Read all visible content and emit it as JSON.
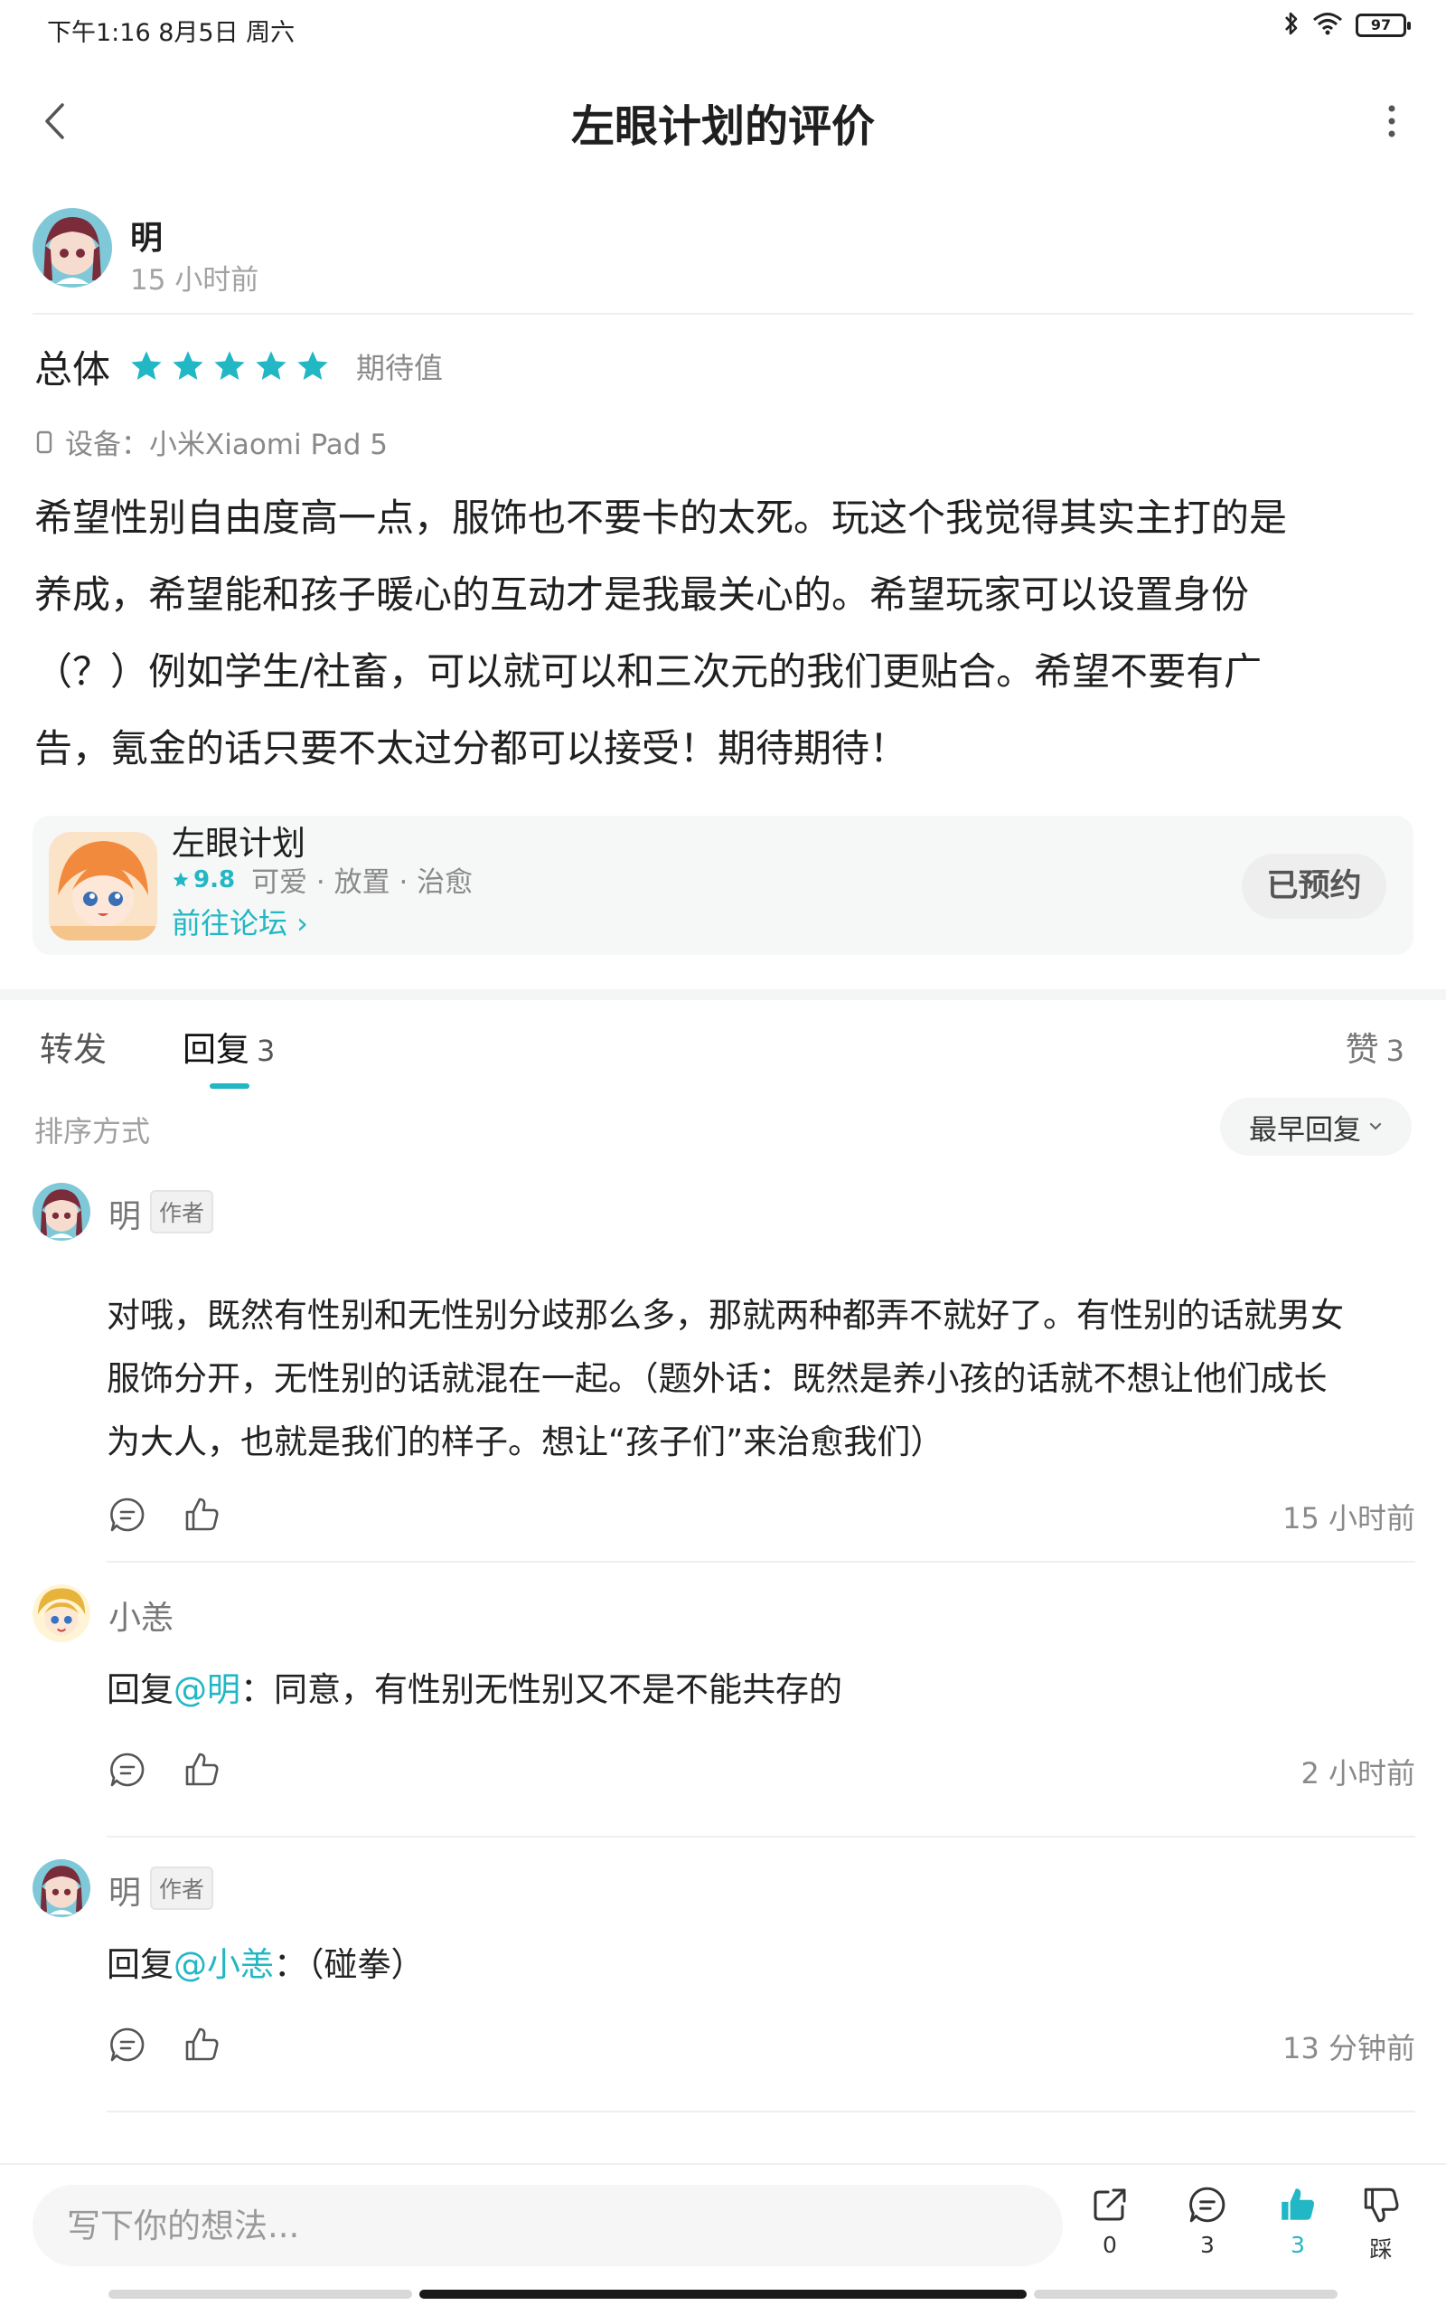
{
  "status_bar": {
    "time_date": "下午1:16  8月5日 周六",
    "battery": "97"
  },
  "nav": {
    "title": "左眼计划的评价"
  },
  "review": {
    "author": "明",
    "time": "15 小时前",
    "rating_label": "总体",
    "stars": 5,
    "rating_tag": "期待值",
    "device_label": "设备：",
    "device": "小米Xiaomi Pad 5",
    "lines": [
      "希望性别自由度高一点，服饰也不要卡的太死。玩这个我觉得其实主打的是",
      "养成，希望能和孩子暖心的互动才是我最关心的。希望玩家可以设置身份",
      "（？）例如学生/社畜，可以就可以和三次元的我们更贴合。希望不要有广",
      "告，氪金的话只要不太过分都可以接受！期待期待！"
    ]
  },
  "game_card": {
    "name": "左眼计划",
    "score": "9.8",
    "tags": "可爱 · 放置 · 治愈",
    "forum_link": "前往论坛 ›",
    "reserve_label": "已预约"
  },
  "tabs": {
    "forward": "转发",
    "reply": "回复",
    "reply_count": "3",
    "like": "赞",
    "like_count": "3"
  },
  "sort": {
    "label": "排序方式",
    "selected": "最早回复"
  },
  "replies": [
    {
      "name": "明",
      "badge": "作者",
      "lines": [
        "对哦，既然有性别和无性别分歧那么多，那就两种都弄不就好了。有性别的话就男女",
        "服饰分开，无性别的话就混在一起。（题外话：既然是养小孩的话就不想让他们成长",
        "为大人，也就是我们的样子。想让“孩子们”来治愈我们）"
      ],
      "time": "15 小时前"
    },
    {
      "name": "小恙",
      "reply_prefix": "回复",
      "mention": "@明",
      "text": "：同意，有性别无性别又不是不能共存的",
      "time": "2 小时前"
    },
    {
      "name": "明",
      "badge": "作者",
      "reply_prefix": "回复",
      "mention": "@小恙",
      "text": "：（碰拳）",
      "time": "13 分钟前"
    }
  ],
  "bottom_bar": {
    "placeholder": "写下你的想法...",
    "share_count": "0",
    "comment_count": "3",
    "like_count": "3",
    "dislike_label": "踩"
  },
  "colors": {
    "accent": "#22b7c4",
    "text": "#1f1f1f",
    "muted": "#8a8a8a"
  }
}
